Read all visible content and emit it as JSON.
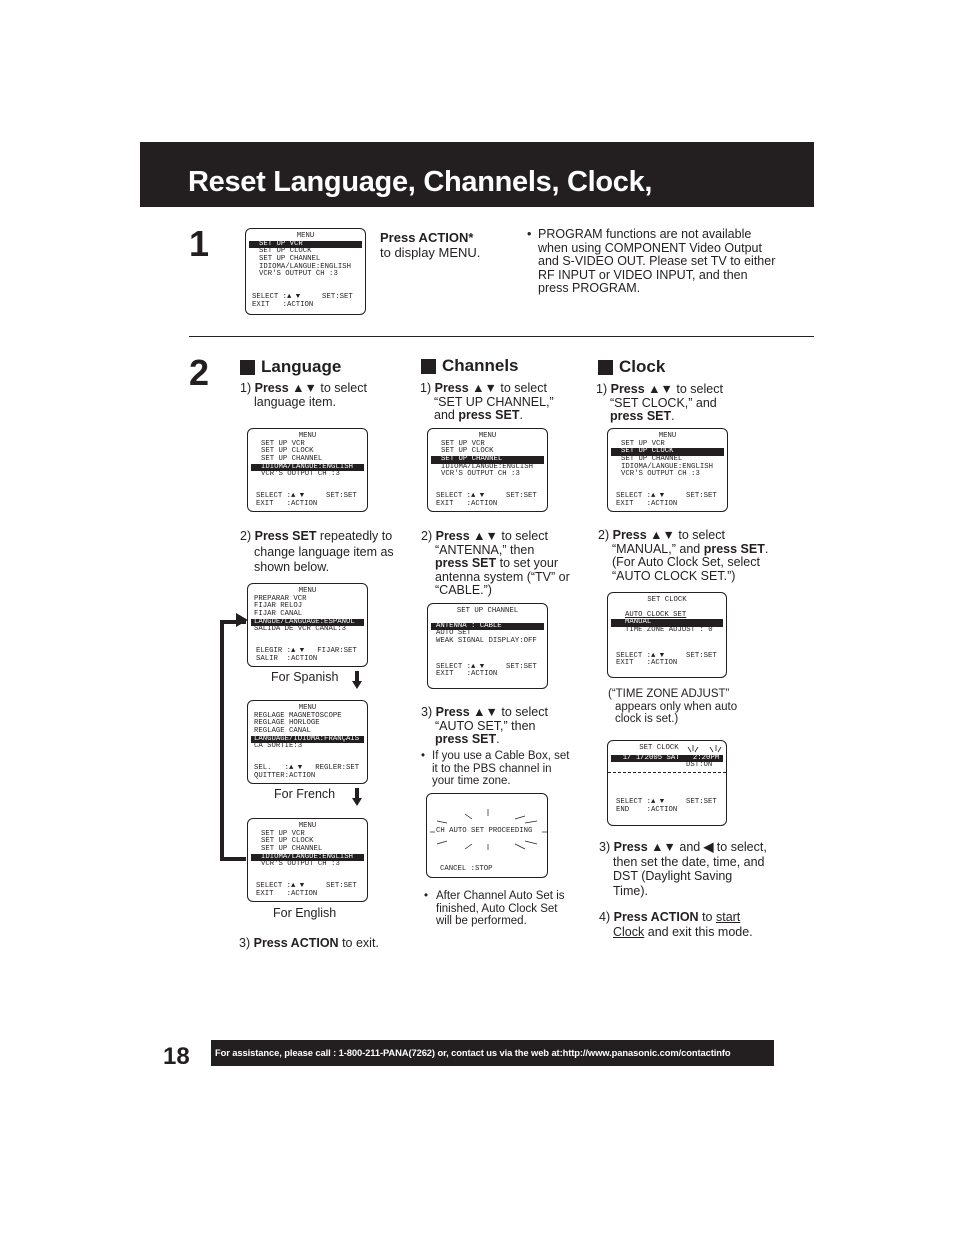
{
  "title": "Reset Language, Channels, Clock,",
  "step1": {
    "number": "1",
    "screen": {
      "header": "MENU",
      "items": [
        "SET UP VCR",
        "SET UP CLOCK",
        "SET UP CHANNEL",
        "IDIOMA/LANGUE:ENGLISH",
        "VCR'S OUTPUT CH :3"
      ],
      "highlight_index": 0,
      "footer1": "SELECT :▲ ▼     SET:SET",
      "footer2": "EXIT   :ACTION"
    },
    "instruction_bold": "Press ACTION*",
    "instruction_rest": "to display MENU.",
    "note": "PROGRAM functions are not available when using COMPONENT Video Output and S-VIDEO OUT. Please set TV to either RF INPUT or VIDEO INPUT, and then press PROGRAM."
  },
  "step2": {
    "number": "2",
    "language": {
      "heading": "Language",
      "s1": {
        "num": "1)",
        "bold": "Press ▲▼",
        "rest": " to select language item."
      },
      "screen1": {
        "header": "MENU",
        "items": [
          "SET UP VCR",
          "SET UP CLOCK",
          "SET UP CHANNEL",
          "IDIOMA/LANGUE:ENGLISH",
          "VCR'S OUTPUT CH :3"
        ],
        "footer1": "SELECT :▲ ▼     SET:SET",
        "footer2": "EXIT   :ACTION"
      },
      "s2": {
        "num": "2)",
        "bold": "Press SET",
        "rest": " repeatedly to change language item as shown below."
      },
      "spanish": {
        "header": "MENU",
        "items": [
          "PREPARAR VCR",
          "FIJAR RELOJ",
          "FIJAR CANAL",
          "LANGUE/LANGUAGE:ESPAÑOL",
          "SALIDA DE VCR CANAL:3"
        ],
        "footer1": "ELEGIR :▲ ▼   FIJAR:SET",
        "footer2": "SALIR  :ACTION",
        "caption": "For Spanish"
      },
      "french": {
        "header": "MENU",
        "items": [
          "REGLAGE MAGNETOSCOPE",
          "REGLAGE HORLOGE",
          "REGLAGE CANAL",
          "LANGUAGE/IDIOMA:FRANÇAIS",
          "CA SORTIE:3"
        ],
        "footer1": "SEL.   :▲ ▼   REGLER:SET",
        "footer2": "QUITTER:ACTION",
        "caption": "For French"
      },
      "english": {
        "header": "MENU",
        "items": [
          "SET UP VCR",
          "SET UP CLOCK",
          "SET UP CHANNEL",
          "IDIOMA/LANGUE:ENGLISH",
          "VCR'S OUTPUT CH :3"
        ],
        "footer1": "SELECT :▲ ▼     SET:SET",
        "footer2": "EXIT   :ACTION",
        "caption": "For English"
      },
      "s3": {
        "num": "3)",
        "bold": "Press ACTION",
        "rest": " to exit."
      }
    },
    "channels": {
      "heading": "Channels",
      "s1": {
        "num": "1)",
        "bold": "Press ▲▼",
        "rest": " to select “SET UP CHANNEL,” and ",
        "bold2": "press SET",
        "end": "."
      },
      "screen1": {
        "header": "MENU",
        "items": [
          "SET UP VCR",
          "SET UP CLOCK",
          "SET UP CHANNEL",
          "IDIOMA/LANGUE:ENGLISH",
          "VCR'S OUTPUT CH :3"
        ],
        "footer1": "SELECT :▲ ▼     SET:SET",
        "footer2": "EXIT   :ACTION"
      },
      "s2": {
        "num": "2)",
        "bold": "Press ▲▼",
        "rest": " to select “ANTENNA,” then ",
        "bold2": "press SET",
        "end": " to set your antenna system (“TV” or “CABLE.”)"
      },
      "screen2": {
        "header": "SET UP CHANNEL",
        "items": [
          "ANTENNA : CABLE",
          "AUTO SET",
          "WEAK SIGNAL DISPLAY:OFF"
        ],
        "footer1": "SELECT :▲ ▼     SET:SET",
        "footer2": "EXIT   :ACTION"
      },
      "s3": {
        "num": "3)",
        "bold": "Press ▲▼",
        "rest": " to select “AUTO SET,” then ",
        "bold2": "press SET",
        "end": "."
      },
      "note1": "If you use a Cable Box, set it to the PBS channel in your time zone.",
      "screen3": {
        "line": "CH AUTO SET PROCEEDING",
        "footer": "CANCEL :STOP"
      },
      "note2": "After Channel Auto Set is finished, Auto Clock Set will be performed."
    },
    "clock": {
      "heading": "Clock",
      "s1": {
        "num": "1)",
        "bold": "Press ▲▼",
        "rest": " to select “SET CLOCK,” and ",
        "bold2": "press SET",
        "end": "."
      },
      "screen1": {
        "header": "MENU",
        "items": [
          "SET UP VCR",
          "SET UP CLOCK",
          "SET UP CHANNEL",
          "IDIOMA/LANGUE:ENGLISH",
          "VCR'S OUTPUT CH :3"
        ],
        "footer1": "SELECT :▲ ▼     SET:SET",
        "footer2": "EXIT   :ACTION"
      },
      "s2": {
        "num": "2)",
        "bold": "Press ▲▼",
        "rest": " to select “MANUAL,” and ",
        "bold2": "press SET",
        "end": ". (For Auto Clock Set, select “AUTO CLOCK SET.”)"
      },
      "screen2": {
        "header": "SET CLOCK",
        "items": [
          "AUTO CLOCK SET",
          "MANUAL",
          "TIME ZONE ADJUST : 0"
        ],
        "footer1": "SELECT :▲ ▼     SET:SET",
        "footer2": "EXIT   :ACTION"
      },
      "note": "(“TIME ZONE ADJUST” appears only when auto clock is set.)",
      "screen3": {
        "header": "SET CLOCK",
        "date_line": "  1/ 1/2005 SAT   2:20PM",
        "dst": "DST:ON",
        "footer1": "SELECT :▲ ▼     SET:SET",
        "footer2": "END    :ACTION"
      },
      "s3": {
        "num": "3)",
        "bold": "Press ▲▼",
        "rest": " and ",
        "bold2": "◀",
        "end": " to select, then set the date, time, and DST (Daylight Saving Time)."
      },
      "s4": {
        "num": "4)",
        "bold": "Press ACTION",
        "rest": " to ",
        "u1": "start",
        "u2": "Clock",
        "end": " and exit this mode."
      }
    }
  },
  "footer": {
    "page_number": "18",
    "assistance": "For assistance, please call : 1-800-211-PANA(7262) or, contact us via the web at:http://www.panasonic.com/contactinfo"
  }
}
